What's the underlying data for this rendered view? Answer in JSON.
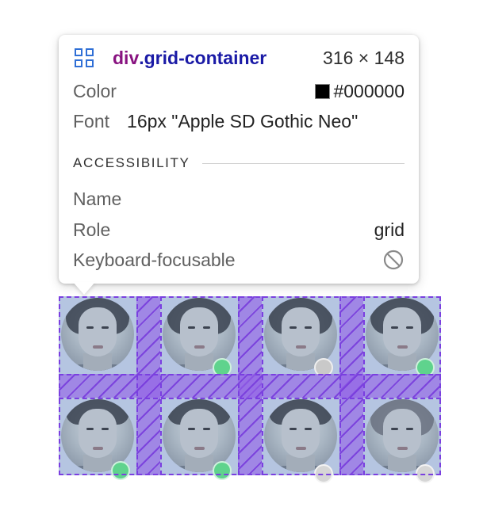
{
  "tooltip": {
    "selector_tag": "div",
    "selector_class": ".grid-container",
    "dimensions": "316 × 148",
    "color_label": "Color",
    "color_value": "#000000",
    "font_label": "Font",
    "font_value": "16px \"Apple SD Gothic Neo\"",
    "accessibility_heading": "ACCESSIBILITY",
    "name_label": "Name",
    "name_value": "",
    "role_label": "Role",
    "role_value": "grid",
    "keyboard_label": "Keyboard-focusable",
    "grid_icon": "grid-layout-icon",
    "keyboard_icon": "not-allowed-icon"
  },
  "overlay": {
    "highlight_color": "#9361e6",
    "border_color": "#7a3fe0",
    "content_color": "#7896c8"
  },
  "grid_items": [
    {
      "status": "none",
      "status_color": ""
    },
    {
      "status": "online",
      "status_color": "#5fd38d"
    },
    {
      "status": "away",
      "status_color": "#c9c9c9"
    },
    {
      "status": "online",
      "status_color": "#5fd38d"
    },
    {
      "status": "online",
      "status_color": "#5fd38d"
    },
    {
      "status": "online",
      "status_color": "#5fd38d"
    },
    {
      "status": "away",
      "status_color": "#d6d6d6"
    },
    {
      "status": "away",
      "status_color": "#d6d6d6"
    }
  ]
}
